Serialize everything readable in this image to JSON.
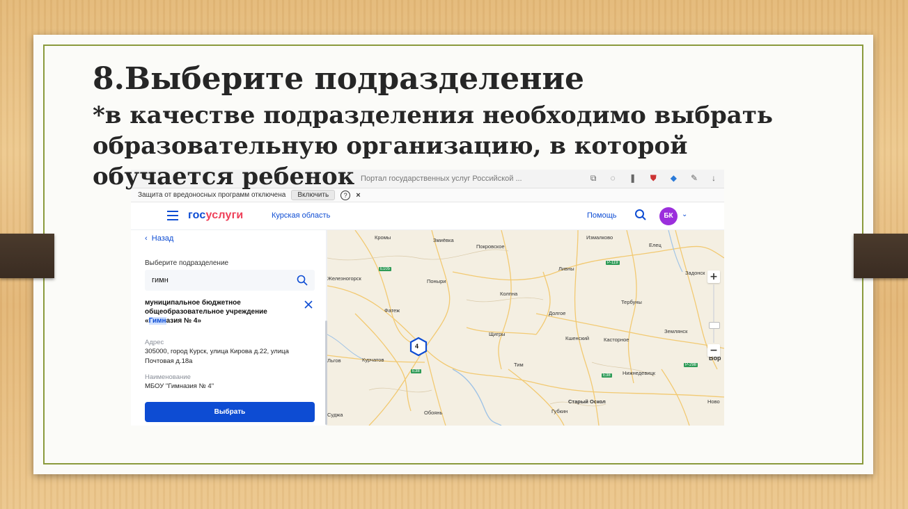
{
  "slide": {
    "title": "8.Выберите подразделение",
    "subtitle": "*в качестве подразделения необходимо выбрать образовательную организацию, в которой обучается ребенок"
  },
  "browser": {
    "url_text": "Портал государственных услуг Российской ...",
    "protection_warning": "Защита от вредоносных программ отключена",
    "enable_button": "Включить",
    "help_mark": "?",
    "close_mark": "×"
  },
  "site": {
    "logo_part1": "гос",
    "logo_part2": "услуги",
    "region": "Курская область",
    "help_link": "Помощь",
    "avatar_initials": "БК",
    "brand_color": "#0d4cd3",
    "accent_color": "#ee3f58"
  },
  "panel": {
    "back_label": "Назад",
    "choose_label": "Выберите подразделение",
    "search_value": "гимн",
    "org_name_before": "муниципальное бюджетное общеобразовательное учреждение «",
    "org_name_highlight": "Гимн",
    "org_name_after": "азия № 4»",
    "address_label": "Адрес",
    "address_value": "305000, город Курск, улица Кирова д.22, улица Почтовая д.18а",
    "name_label": "Наименование",
    "name_value": "МБОУ \"Гимназия № 4\"",
    "select_button": "Выбрать"
  },
  "map": {
    "cluster_count": "4",
    "zoom_in": "+",
    "zoom_out": "−",
    "labels": {
      "kromy": "Кромы",
      "zmievka": "Змиёвка",
      "pokrovskoe": "Покровское",
      "izmalkovo": "Измалково",
      "elets": "Елец",
      "zheleznogorsk": "Железногорск",
      "livny": "Ливны",
      "zadonsk": "Задонск",
      "ponyri": "Поныри",
      "kolpna": "Колпна",
      "terbuny": "Тербуны",
      "fatezh": "Фатеж",
      "dolgoe": "Долгое",
      "shchigry": "Щигры",
      "kshensky": "Кшенский",
      "kastornoe": "Касторное",
      "zemlyansk": "Землянск",
      "lgov": "Льгов",
      "kurchatov": "Курчатов",
      "tim": "Тим",
      "nizhnedevitsk": "Нижнедевицк",
      "vor": "Вор",
      "stary_oskol": "Старый Оскол",
      "novo": "Ново",
      "sudzha": "Суджа",
      "oboyan": "Обоянь",
      "gubkin": "Губкин"
    },
    "roads": {
      "e105": "E105",
      "r119": "P-119",
      "e38a": "E38",
      "e38b": "E38",
      "r298": "P-298"
    }
  }
}
